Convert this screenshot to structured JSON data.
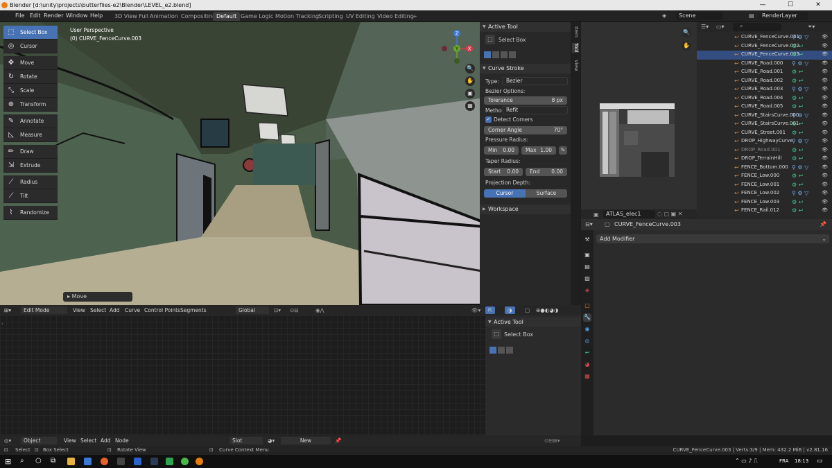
{
  "window": {
    "title": "Blender [d:\\unity\\projects\\butterflies-e2\\Blender\\LEVEL_e2.blend]",
    "minimize": "—",
    "maximize": "☐",
    "close": "✕"
  },
  "menu": [
    "File",
    "Edit",
    "Render",
    "Window",
    "Help"
  ],
  "workspaces": [
    "3D View Full",
    "Animation",
    "Compositing",
    "Default",
    "Game Logic",
    "Motion Tracking",
    "Scripting",
    "UV Editing",
    "Video Editing",
    "+"
  ],
  "active_workspace": "Default",
  "scene": {
    "scene": "Scene",
    "view_layer": "RenderLayer"
  },
  "toolbar": [
    {
      "label": "Select Box",
      "icon": "select-box-icon",
      "glyph": "⬚",
      "active": true
    },
    {
      "label": "Cursor",
      "icon": "cursor-icon",
      "glyph": "◎"
    },
    {
      "label": "Move",
      "icon": "move-icon",
      "glyph": "✥"
    },
    {
      "label": "Rotate",
      "icon": "rotate-icon",
      "glyph": "↻"
    },
    {
      "label": "Scale",
      "icon": "scale-icon",
      "glyph": "⤡"
    },
    {
      "label": "Transform",
      "icon": "transform-icon",
      "glyph": "⊕"
    },
    {
      "label": "Annotate",
      "icon": "annotate-icon",
      "glyph": "✎"
    },
    {
      "label": "Measure",
      "icon": "measure-icon",
      "glyph": "◺"
    },
    {
      "label": "Draw",
      "icon": "draw-icon",
      "glyph": "✏"
    },
    {
      "label": "Extrude",
      "icon": "extrude-icon",
      "glyph": "⇲"
    },
    {
      "label": "Radius",
      "icon": "radius-icon",
      "glyph": "⟋"
    },
    {
      "label": "Tilt",
      "icon": "tilt-icon",
      "glyph": "⟋"
    },
    {
      "label": "Randomize",
      "icon": "randomize-icon",
      "glyph": "⌇"
    }
  ],
  "viewport": {
    "perspective": "User Perspective",
    "object": "(0) CURVE_FenceCurve.003",
    "last_op": "Move",
    "gizmo": {
      "x": "X",
      "y": "Y",
      "z": "Z"
    },
    "header": {
      "mode": "Edit Mode",
      "menus": [
        "View",
        "Select",
        "Add",
        "Curve",
        "Control Points",
        "Segments"
      ],
      "orientation": "Global"
    }
  },
  "npanel": {
    "active_tool_title": "Active Tool",
    "active_tool": "Select Box",
    "curve_stroke_title": "Curve Stroke",
    "type_label": "Type:",
    "type_value": "Bezier",
    "bezier_options": "Bezier Options:",
    "tolerance_label": "Tolerance",
    "tolerance_value": "8 px",
    "method_label": "Method:",
    "method_value": "Refit",
    "detect_corners": "Detect Corners",
    "corner_angle_label": "Corner Angle",
    "corner_angle_value": "70°",
    "pressure_radius": "Pressure Radius:",
    "min_label": "Min",
    "min_value": "0.00",
    "max_label": "Max",
    "max_value": "1.00",
    "taper_radius": "Taper Radius:",
    "start_label": "Start",
    "start_value": "0.00",
    "end_label": "End",
    "end_value": "0.00",
    "projection_depth": "Projection Depth:",
    "proj_cursor": "Cursor",
    "proj_surface": "Surface",
    "workspace_title": "Workspace",
    "tabs": [
      "Item",
      "Tool",
      "View"
    ],
    "active_tab": "Tool"
  },
  "image_preview": {
    "image_name": "ATLAS_elec1"
  },
  "outliner": {
    "search_placeholder": "",
    "rows": [
      {
        "name": "CURVE_FenceCurve.001"
      },
      {
        "name": "CURVE_FenceCurve.002"
      },
      {
        "name": "CURVE_FenceCurve.003",
        "selected": true
      },
      {
        "name": "CURVE_Road.000"
      },
      {
        "name": "CURVE_Road.001"
      },
      {
        "name": "CURVE_Road.002"
      },
      {
        "name": "CURVE_Road.003"
      },
      {
        "name": "CURVE_Road.004"
      },
      {
        "name": "CURVE_Road.005"
      },
      {
        "name": "CURVE_StairsCurve.000"
      },
      {
        "name": "CURVE_StairsCurve.001"
      },
      {
        "name": "CURVE_Street.001"
      },
      {
        "name": "DROP_HighwayCurve"
      },
      {
        "name": "DROP_Road.001",
        "dim": true
      },
      {
        "name": "DROP_TerrainHill"
      },
      {
        "name": "FENCE_Bottom.000"
      },
      {
        "name": "FENCE_Low.000"
      },
      {
        "name": "FENCE_Low.001"
      },
      {
        "name": "FENCE_Low.002"
      },
      {
        "name": "FENCE_Low.003"
      },
      {
        "name": "FENCE_Rail.012"
      }
    ]
  },
  "properties": {
    "object": "CURVE_FenceCurve.003",
    "add_modifier": "Add Modifier"
  },
  "node_editor": {
    "sidebar_title": "Active Tool",
    "sidebar_tool": "Select Box",
    "header": {
      "mode": "Object",
      "menus": [
        "View",
        "Select",
        "Add",
        "Node"
      ],
      "slot": "Slot",
      "new_btn": "New"
    }
  },
  "status": {
    "select": "Select",
    "box_select": "Box Select",
    "rotate_view": "Rotate View",
    "context_menu": "Curve Context Menu",
    "stats": "CURVE_FenceCurve.003 | Verts:3/9 | Mem: 432.2 MiB | v2.81.16"
  },
  "taskbar": {
    "lang": "FRA",
    "time": "18:13"
  },
  "colors": {
    "accent": "#4772b3",
    "orange": "#e87d0d",
    "bg": "#1d1d1d"
  }
}
